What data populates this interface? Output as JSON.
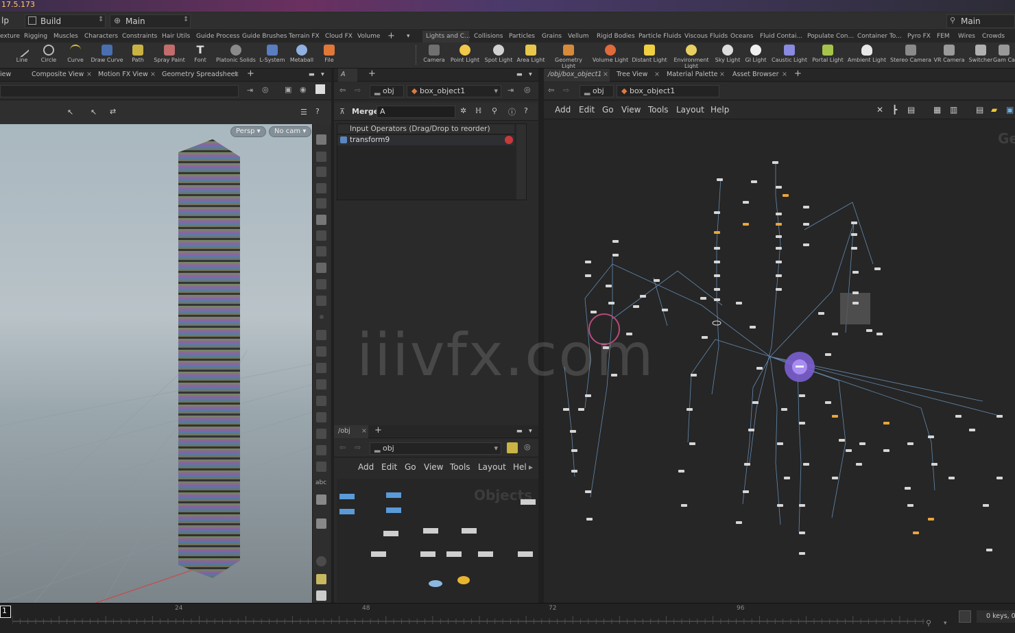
{
  "title": {
    "version": "17.5.173"
  },
  "menubar": {
    "help_fragment": "lp",
    "build_label": "Build",
    "main_label": "Main",
    "right_main_label": "Main"
  },
  "shelf_tabs_left": [
    "exture",
    "Rigging",
    "Muscles",
    "Characters",
    "Constraints",
    "Hair Utils",
    "Guide Process",
    "Guide Brushes",
    "Terrain FX",
    "Cloud FX",
    "Volume"
  ],
  "shelf_tabs_right": [
    "Lights and C...",
    "Collisions",
    "Particles",
    "Grains",
    "Vellum",
    "Rigid Bodies",
    "Particle Fluids",
    "Viscous Fluids",
    "Oceans",
    "Fluid Contai...",
    "Populate Con...",
    "Container To...",
    "Pyro FX",
    "FEM",
    "Wires",
    "Crowds"
  ],
  "tools_left": [
    "Line",
    "Circle",
    "Curve",
    "Draw Curve",
    "Path",
    "Spray Paint",
    "Font",
    "Platonic Solids",
    "L-System",
    "Metaball",
    "File"
  ],
  "tools_right": [
    "Camera",
    "Point Light",
    "Spot Light",
    "Area Light",
    "Geometry Light",
    "Volume Light",
    "Distant Light",
    "Environment Light",
    "Sky Light",
    "GI Light",
    "Caustic Light",
    "Portal Light",
    "Ambient Light",
    "Stereo Camera",
    "VR Camera",
    "Switcher",
    "Gam Ca"
  ],
  "left_pane": {
    "tabs": [
      "iew",
      "Composite View",
      "Motion FX View",
      "Geometry Spreadsheet"
    ],
    "persp": "Persp",
    "nocam": "No cam"
  },
  "mid_pane": {
    "tab": "A",
    "path_root": "obj",
    "path_node": "box_object1",
    "node_type": "Merge",
    "node_name": "A",
    "input_header": "Input Operators (Drag/Drop to reorder)",
    "input_item": "transform9",
    "bottom_tab": "/obj",
    "bottom_path": "obj",
    "bottom_menu": [
      "Add",
      "Edit",
      "Go",
      "View",
      "Tools",
      "Layout",
      "Hel"
    ],
    "objects_label": "Objects"
  },
  "network_pane": {
    "tabs": [
      "/obj/box_object1",
      "Tree View",
      "Material Palette",
      "Asset Browser"
    ],
    "path_root": "obj",
    "path_node": "box_object1",
    "menu": [
      "Add",
      "Edit",
      "Go",
      "View",
      "Tools",
      "Layout",
      "Help"
    ],
    "corner_label": "Ge"
  },
  "timeline": {
    "frame": "1",
    "ticks": [
      "24",
      "48",
      "72",
      "96"
    ],
    "keys": "0 keys, 0"
  },
  "watermark": "iiivfx.com"
}
